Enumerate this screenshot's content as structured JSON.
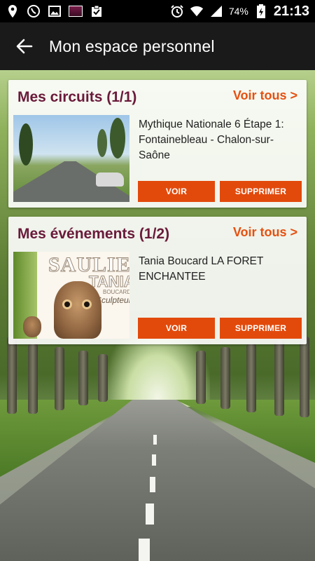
{
  "status_bar": {
    "time": "21:13",
    "battery": "74%",
    "icons": [
      "location-icon",
      "viber-icon",
      "photo-icon",
      "notification-thumbnail",
      "clipboard-icon",
      "alarm-icon",
      "wifi-icon",
      "signal-icon",
      "battery-icon"
    ]
  },
  "app_bar": {
    "title": "Mon espace personnel",
    "back_icon": "arrow-left-icon"
  },
  "circuits": {
    "title": "Mes circuits (1/1)",
    "see_all": "Voir tous >",
    "item": {
      "description": "Mythique Nationale 6 Étape 1: Fontainebleau - Chalon-sur-Saône",
      "view_label": "VOIR",
      "delete_label": "SUPPRIMER"
    }
  },
  "events": {
    "title": "Mes événements (1/2)",
    "see_all": "Voir tous >",
    "item": {
      "description": "Tania Boucard LA FORET ENCHANTEE",
      "view_label": "VOIR",
      "delete_label": "SUPPRIMER",
      "poster_text": {
        "line1": "SAULIEU",
        "line2": "TANIA",
        "line3": "BOUCARD",
        "line4": "Sculpteur"
      }
    }
  },
  "colors": {
    "accent": "#e24a0c",
    "title": "#6a1a3a",
    "app_bar": "#1a1a1a"
  }
}
